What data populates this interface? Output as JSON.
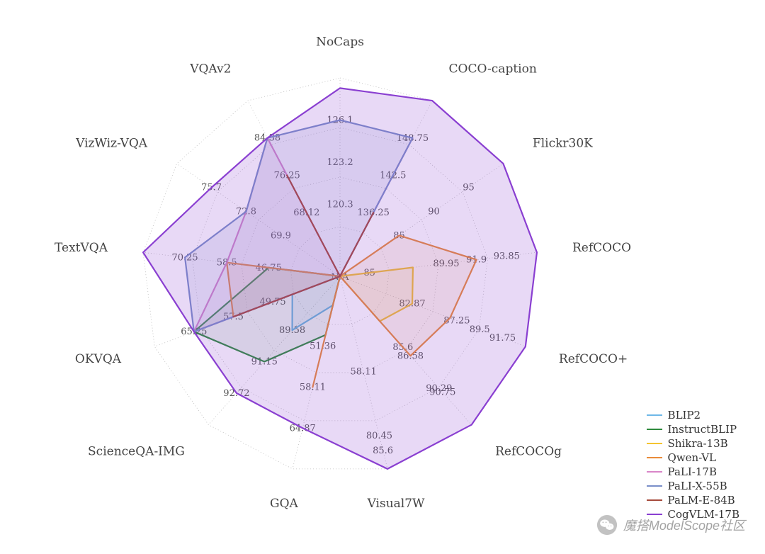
{
  "chart_data": {
    "type": "radar",
    "categories": [
      "NoCaps",
      "COCO-caption",
      "Flickr30K",
      "RefCOCO",
      "RefCOCO+",
      "RefCOCOg",
      "Visual7W",
      "GQA",
      "ScienceQA-IMG",
      "OKVQA",
      "TextVQA",
      "VizWiz-VQA",
      "VQAv2"
    ],
    "axis_ticks": [
      {
        "axis": "NoCaps",
        "ticks": [
          120.3,
          123.2,
          126.1
        ],
        "min": 117.4,
        "max": 129.0
      },
      {
        "axis": "COCO-caption",
        "ticks": [
          136.25,
          142.5,
          148.75
        ],
        "min": 130.0,
        "max": 155.0
      },
      {
        "axis": "Flickr30K",
        "ticks": [
          85.0,
          90.0,
          95.0
        ],
        "min": 80.0,
        "max": 100.0
      },
      {
        "axis": "RefCOCO",
        "ticks": [
          85.0,
          89.95,
          91.9,
          93.85
        ],
        "min": 85.0,
        "max": 95.8
      },
      {
        "axis": "RefCOCO+",
        "ticks": [
          82.87,
          87.25,
          89.5,
          91.75
        ],
        "min": 78.5,
        "max": 94.0
      },
      {
        "axis": "RefCOCOg",
        "ticks": [
          85.6,
          86.58,
          90.29,
          90.75
        ],
        "min": 80.0,
        "max": 94.5
      },
      {
        "axis": "Visual7W",
        "ticks": [
          58.11,
          80.45,
          85.6
        ],
        "min": 35.0,
        "max": 92.0
      },
      {
        "axis": "GQA",
        "ticks": [
          51.36,
          58.11,
          64.87
        ],
        "min": 44.6,
        "max": 71.6
      },
      {
        "axis": "ScienceQA-IMG",
        "ticks": [
          89.58,
          91.15,
          92.72
        ],
        "min": 88.0,
        "max": 94.3
      },
      {
        "axis": "OKVQA",
        "ticks": [
          49.75,
          57.5,
          65.25
        ],
        "min": 42.0,
        "max": 73.0
      },
      {
        "axis": "TextVQA",
        "ticks": [
          46.75,
          58.5,
          70.25
        ],
        "min": 35.0,
        "max": 82.0
      },
      {
        "axis": "VizWiz-VQA",
        "ticks": [
          69.9,
          72.8,
          75.7
        ],
        "min": 67.0,
        "max": 78.6
      },
      {
        "axis": "VQAv2",
        "ticks": [
          68.12,
          76.25,
          84.38
        ],
        "min": 60.0,
        "max": 92.5
      }
    ],
    "center_label": "N/A",
    "series": [
      {
        "name": "BLIP2",
        "color": "#6fb8e8",
        "values": {
          "NoCaps": null,
          "COCO-caption": null,
          "Flickr30K": null,
          "RefCOCO": null,
          "RefCOCO+": null,
          "RefCOCOg": null,
          "Visual7W": null,
          "GQA": 44.6,
          "ScienceQA-IMG": 89.58,
          "OKVQA": 45.9,
          "TextVQA": null,
          "VizWiz-VQA": null,
          "VQAv2": null
        }
      },
      {
        "name": "InstructBLIP",
        "color": "#2e8b3d",
        "values": {
          "NoCaps": null,
          "COCO-caption": null,
          "Flickr30K": null,
          "RefCOCO": null,
          "RefCOCO+": null,
          "RefCOCOg": null,
          "Visual7W": null,
          "GQA": 49.5,
          "ScienceQA-IMG": 91.15,
          "OKVQA": 65.25,
          "TextVQA": 46.75,
          "VizWiz-VQA": null,
          "VQAv2": null
        }
      },
      {
        "name": "Shikra-13B",
        "color": "#f4c430",
        "values": {
          "NoCaps": null,
          "COCO-caption": null,
          "Flickr30K": null,
          "RefCOCO": 87.8,
          "RefCOCO+": 82.87,
          "RefCOCOg": 82.6,
          "Visual7W": null,
          "GQA": null,
          "ScienceQA-IMG": null,
          "OKVQA": null,
          "TextVQA": null,
          "VizWiz-VQA": null,
          "VQAv2": null
        }
      },
      {
        "name": "Qwen-VL",
        "color": "#e98b3a",
        "values": {
          "NoCaps": null,
          "COCO-caption": null,
          "Flickr30K": 85.0,
          "RefCOCO": 91.9,
          "RefCOCO+": 86.58,
          "RefCOCOg": 86.58,
          "Visual7W": null,
          "GQA": 58.11,
          "ScienceQA-IMG": null,
          "OKVQA": 57.5,
          "TextVQA": 58.5,
          "VizWiz-VQA": null,
          "VQAv2": null
        }
      },
      {
        "name": "PaLI-17B",
        "color": "#d986c8",
        "values": {
          "NoCaps": null,
          "COCO-caption": 148.75,
          "Flickr30K": null,
          "RefCOCO": null,
          "RefCOCO+": null,
          "RefCOCOg": null,
          "Visual7W": null,
          "GQA": null,
          "ScienceQA-IMG": null,
          "OKVQA": 65.25,
          "TextVQA": 58.5,
          "VizWiz-VQA": 72.8,
          "VQAv2": 84.38
        }
      },
      {
        "name": "PaLI-X-55B",
        "color": "#7a8fc9",
        "values": {
          "NoCaps": 126.1,
          "COCO-caption": 148.75,
          "Flickr30K": null,
          "RefCOCO": null,
          "RefCOCO+": null,
          "RefCOCOg": null,
          "Visual7W": null,
          "GQA": null,
          "ScienceQA-IMG": null,
          "OKVQA": 65.25,
          "TextVQA": 70.25,
          "VizWiz-VQA": 72.8,
          "VQAv2": 84.38
        }
      },
      {
        "name": "PaLM-E-84B",
        "color": "#a64b3c",
        "values": {
          "NoCaps": null,
          "COCO-caption": 136.25,
          "Flickr30K": null,
          "RefCOCO": null,
          "RefCOCO+": null,
          "RefCOCOg": null,
          "Visual7W": null,
          "GQA": null,
          "ScienceQA-IMG": null,
          "OKVQA": 57.5,
          "TextVQA": null,
          "VizWiz-VQA": null,
          "VQAv2": 76.25
        }
      },
      {
        "name": "CogVLM-17B",
        "color": "#8a3fd1",
        "values": {
          "NoCaps": 128.3,
          "COCO-caption": 155.0,
          "Flickr30K": 100.0,
          "RefCOCO": 95.8,
          "RefCOCO+": 94.0,
          "RefCOCOg": 94.5,
          "Visual7W": 92.0,
          "GQA": 64.87,
          "ScienceQA-IMG": 92.72,
          "OKVQA": 65.25,
          "TextVQA": 82.0,
          "VizWiz-VQA": 75.7,
          "VQAv2": 84.38
        }
      }
    ],
    "legend": [
      "BLIP2",
      "InstructBLIP",
      "Shikra-13B",
      "Qwen-VL",
      "PaLI-17B",
      "PaLI-X-55B",
      "PaLM-E-84B",
      "CogVLM-17B"
    ],
    "colors": {
      "BLIP2": "#6fb8e8",
      "InstructBLIP": "#2e8b3d",
      "Shikra-13B": "#f4c430",
      "Qwen-VL": "#e98b3a",
      "PaLI-17B": "#d986c8",
      "PaLI-X-55B": "#7a8fc9",
      "PaLM-E-84B": "#a64b3c",
      "CogVLM-17B": "#8a3fd1"
    }
  },
  "watermark": {
    "text": "魔搭ModelScope社区"
  }
}
